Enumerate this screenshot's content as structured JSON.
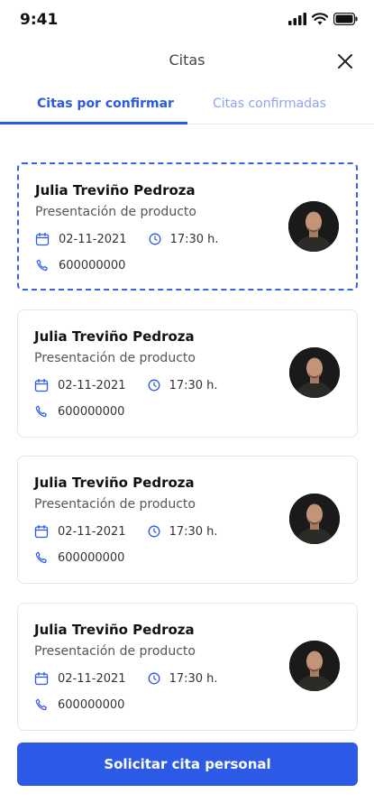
{
  "status_bar": {
    "time": "9:41"
  },
  "header": {
    "title": "Citas"
  },
  "tabs": [
    {
      "label": "Citas por confirmar",
      "active": true
    },
    {
      "label": "Citas confirmadas",
      "active": false
    }
  ],
  "appointments": [
    {
      "name": "Julia Treviño Pedroza",
      "topic": "Presentación de producto",
      "date": "02-11-2021",
      "time": "17:30 h.",
      "phone": "600000000",
      "selected": true
    },
    {
      "name": "Julia Treviño Pedroza",
      "topic": "Presentación de producto",
      "date": "02-11-2021",
      "time": "17:30 h.",
      "phone": "600000000",
      "selected": false
    },
    {
      "name": "Julia Treviño Pedroza",
      "topic": "Presentación de producto",
      "date": "02-11-2021",
      "time": "17:30 h.",
      "phone": "600000000",
      "selected": false
    },
    {
      "name": "Julia Treviño Pedroza",
      "topic": "Presentación de producto",
      "date": "02-11-2021",
      "time": "17:30 h.",
      "phone": "600000000",
      "selected": false
    }
  ],
  "icons": {
    "date": "calendar-icon",
    "time": "clock-icon",
    "phone": "phone-icon",
    "close": "close-icon"
  },
  "cta": {
    "label": "Solicitar cita personal"
  },
  "colors": {
    "primary": "#2c59e6",
    "tab_inactive": "#8fa4f0",
    "border": "#e3e5ea"
  }
}
